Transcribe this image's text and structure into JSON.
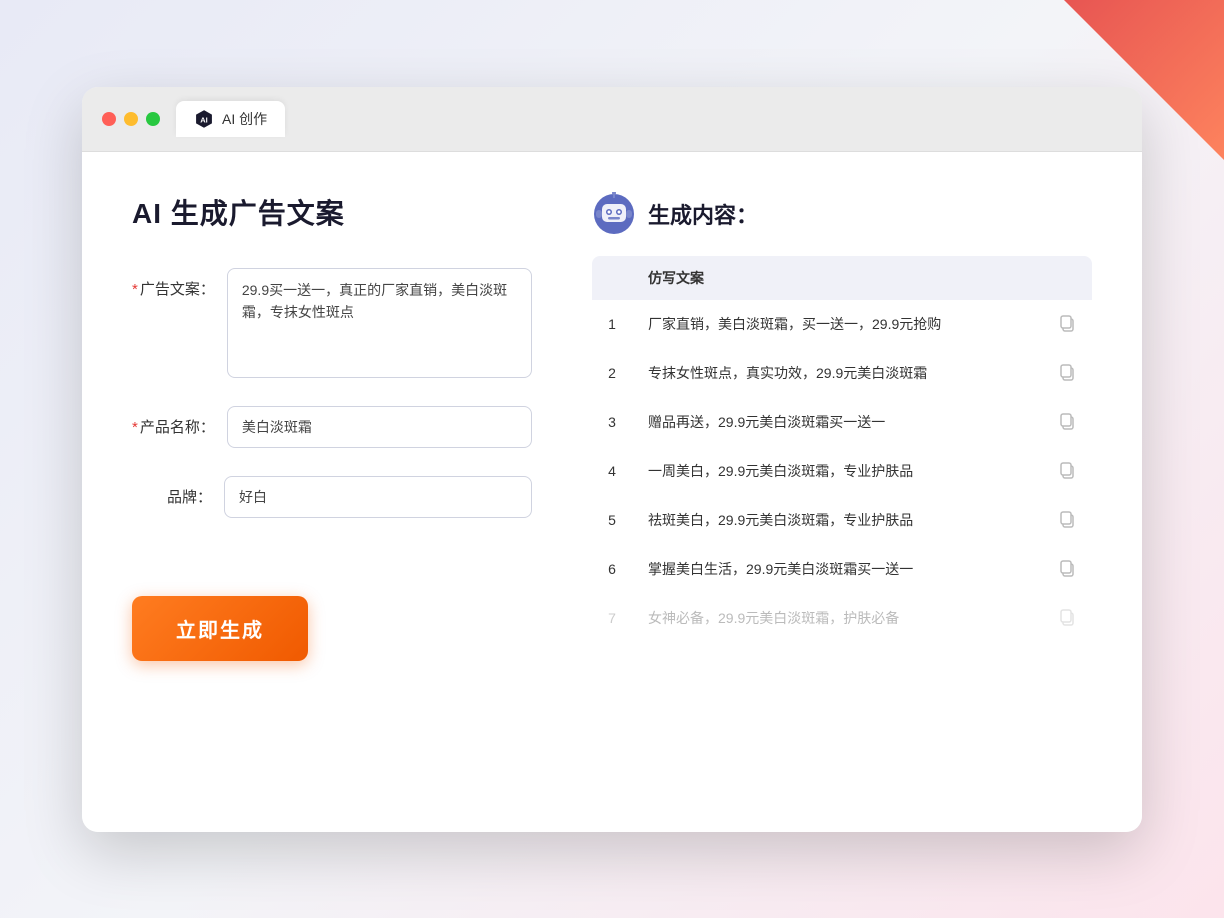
{
  "browser": {
    "tab_label": "AI 创作"
  },
  "page": {
    "title": "AI 生成广告文案"
  },
  "form": {
    "ad_copy_label": "广告文案：",
    "ad_copy_required": "*",
    "ad_copy_value": "29.9买一送一，真正的厂家直销，美白淡斑霜，专抹女性斑点",
    "product_name_label": "产品名称：",
    "product_name_required": "*",
    "product_name_value": "美白淡斑霜",
    "brand_label": "品牌：",
    "brand_value": "好白",
    "generate_btn_label": "立即生成"
  },
  "result": {
    "header": "生成内容：",
    "table_header": "仿写文案",
    "items": [
      {
        "id": 1,
        "text": "厂家直销，美白淡斑霜，买一送一，29.9元抢购"
      },
      {
        "id": 2,
        "text": "专抹女性斑点，真实功效，29.9元美白淡斑霜"
      },
      {
        "id": 3,
        "text": "赠品再送，29.9元美白淡斑霜买一送一"
      },
      {
        "id": 4,
        "text": "一周美白，29.9元美白淡斑霜，专业护肤品"
      },
      {
        "id": 5,
        "text": "祛斑美白，29.9元美白淡斑霜，专业护肤品"
      },
      {
        "id": 6,
        "text": "掌握美白生活，29.9元美白淡斑霜买一送一"
      },
      {
        "id": 7,
        "text": "女神必备，29.9元美白淡斑霜，护肤必备",
        "faded": true
      }
    ]
  }
}
